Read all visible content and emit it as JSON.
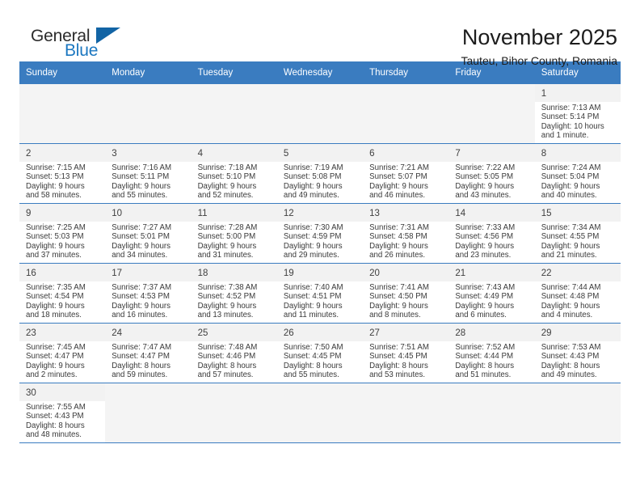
{
  "brand": {
    "name_part1": "General",
    "name_part2": "Blue",
    "triangle_icon": "triangle-icon",
    "accent_color": "#1b77c0"
  },
  "header": {
    "title": "November 2025",
    "subtitle": "Tauteu, Bihor County, Romania"
  },
  "theme": {
    "header_row_bg": "#3a7cc0",
    "header_row_text": "#ffffff",
    "daynum_bar_bg": "#f2f2f2",
    "grid_line": "#3a7cc0"
  },
  "weekdays": [
    {
      "label": "Sunday"
    },
    {
      "label": "Monday"
    },
    {
      "label": "Tuesday"
    },
    {
      "label": "Wednesday"
    },
    {
      "label": "Thursday"
    },
    {
      "label": "Friday"
    },
    {
      "label": "Saturday"
    }
  ],
  "weeks": [
    [
      {
        "empty": true
      },
      {
        "empty": true
      },
      {
        "empty": true
      },
      {
        "empty": true
      },
      {
        "empty": true
      },
      {
        "empty": true
      },
      {
        "day": "1",
        "sunrise": "Sunrise: 7:13 AM",
        "sunset": "Sunset: 5:14 PM",
        "daylight1": "Daylight: 10 hours",
        "daylight2": "and 1 minute."
      }
    ],
    [
      {
        "day": "2",
        "sunrise": "Sunrise: 7:15 AM",
        "sunset": "Sunset: 5:13 PM",
        "daylight1": "Daylight: 9 hours",
        "daylight2": "and 58 minutes."
      },
      {
        "day": "3",
        "sunrise": "Sunrise: 7:16 AM",
        "sunset": "Sunset: 5:11 PM",
        "daylight1": "Daylight: 9 hours",
        "daylight2": "and 55 minutes."
      },
      {
        "day": "4",
        "sunrise": "Sunrise: 7:18 AM",
        "sunset": "Sunset: 5:10 PM",
        "daylight1": "Daylight: 9 hours",
        "daylight2": "and 52 minutes."
      },
      {
        "day": "5",
        "sunrise": "Sunrise: 7:19 AM",
        "sunset": "Sunset: 5:08 PM",
        "daylight1": "Daylight: 9 hours",
        "daylight2": "and 49 minutes."
      },
      {
        "day": "6",
        "sunrise": "Sunrise: 7:21 AM",
        "sunset": "Sunset: 5:07 PM",
        "daylight1": "Daylight: 9 hours",
        "daylight2": "and 46 minutes."
      },
      {
        "day": "7",
        "sunrise": "Sunrise: 7:22 AM",
        "sunset": "Sunset: 5:05 PM",
        "daylight1": "Daylight: 9 hours",
        "daylight2": "and 43 minutes."
      },
      {
        "day": "8",
        "sunrise": "Sunrise: 7:24 AM",
        "sunset": "Sunset: 5:04 PM",
        "daylight1": "Daylight: 9 hours",
        "daylight2": "and 40 minutes."
      }
    ],
    [
      {
        "day": "9",
        "sunrise": "Sunrise: 7:25 AM",
        "sunset": "Sunset: 5:03 PM",
        "daylight1": "Daylight: 9 hours",
        "daylight2": "and 37 minutes."
      },
      {
        "day": "10",
        "sunrise": "Sunrise: 7:27 AM",
        "sunset": "Sunset: 5:01 PM",
        "daylight1": "Daylight: 9 hours",
        "daylight2": "and 34 minutes."
      },
      {
        "day": "11",
        "sunrise": "Sunrise: 7:28 AM",
        "sunset": "Sunset: 5:00 PM",
        "daylight1": "Daylight: 9 hours",
        "daylight2": "and 31 minutes."
      },
      {
        "day": "12",
        "sunrise": "Sunrise: 7:30 AM",
        "sunset": "Sunset: 4:59 PM",
        "daylight1": "Daylight: 9 hours",
        "daylight2": "and 29 minutes."
      },
      {
        "day": "13",
        "sunrise": "Sunrise: 7:31 AM",
        "sunset": "Sunset: 4:58 PM",
        "daylight1": "Daylight: 9 hours",
        "daylight2": "and 26 minutes."
      },
      {
        "day": "14",
        "sunrise": "Sunrise: 7:33 AM",
        "sunset": "Sunset: 4:56 PM",
        "daylight1": "Daylight: 9 hours",
        "daylight2": "and 23 minutes."
      },
      {
        "day": "15",
        "sunrise": "Sunrise: 7:34 AM",
        "sunset": "Sunset: 4:55 PM",
        "daylight1": "Daylight: 9 hours",
        "daylight2": "and 21 minutes."
      }
    ],
    [
      {
        "day": "16",
        "sunrise": "Sunrise: 7:35 AM",
        "sunset": "Sunset: 4:54 PM",
        "daylight1": "Daylight: 9 hours",
        "daylight2": "and 18 minutes."
      },
      {
        "day": "17",
        "sunrise": "Sunrise: 7:37 AM",
        "sunset": "Sunset: 4:53 PM",
        "daylight1": "Daylight: 9 hours",
        "daylight2": "and 16 minutes."
      },
      {
        "day": "18",
        "sunrise": "Sunrise: 7:38 AM",
        "sunset": "Sunset: 4:52 PM",
        "daylight1": "Daylight: 9 hours",
        "daylight2": "and 13 minutes."
      },
      {
        "day": "19",
        "sunrise": "Sunrise: 7:40 AM",
        "sunset": "Sunset: 4:51 PM",
        "daylight1": "Daylight: 9 hours",
        "daylight2": "and 11 minutes."
      },
      {
        "day": "20",
        "sunrise": "Sunrise: 7:41 AM",
        "sunset": "Sunset: 4:50 PM",
        "daylight1": "Daylight: 9 hours",
        "daylight2": "and 8 minutes."
      },
      {
        "day": "21",
        "sunrise": "Sunrise: 7:43 AM",
        "sunset": "Sunset: 4:49 PM",
        "daylight1": "Daylight: 9 hours",
        "daylight2": "and 6 minutes."
      },
      {
        "day": "22",
        "sunrise": "Sunrise: 7:44 AM",
        "sunset": "Sunset: 4:48 PM",
        "daylight1": "Daylight: 9 hours",
        "daylight2": "and 4 minutes."
      }
    ],
    [
      {
        "day": "23",
        "sunrise": "Sunrise: 7:45 AM",
        "sunset": "Sunset: 4:47 PM",
        "daylight1": "Daylight: 9 hours",
        "daylight2": "and 2 minutes."
      },
      {
        "day": "24",
        "sunrise": "Sunrise: 7:47 AM",
        "sunset": "Sunset: 4:47 PM",
        "daylight1": "Daylight: 8 hours",
        "daylight2": "and 59 minutes."
      },
      {
        "day": "25",
        "sunrise": "Sunrise: 7:48 AM",
        "sunset": "Sunset: 4:46 PM",
        "daylight1": "Daylight: 8 hours",
        "daylight2": "and 57 minutes."
      },
      {
        "day": "26",
        "sunrise": "Sunrise: 7:50 AM",
        "sunset": "Sunset: 4:45 PM",
        "daylight1": "Daylight: 8 hours",
        "daylight2": "and 55 minutes."
      },
      {
        "day": "27",
        "sunrise": "Sunrise: 7:51 AM",
        "sunset": "Sunset: 4:45 PM",
        "daylight1": "Daylight: 8 hours",
        "daylight2": "and 53 minutes."
      },
      {
        "day": "28",
        "sunrise": "Sunrise: 7:52 AM",
        "sunset": "Sunset: 4:44 PM",
        "daylight1": "Daylight: 8 hours",
        "daylight2": "and 51 minutes."
      },
      {
        "day": "29",
        "sunrise": "Sunrise: 7:53 AM",
        "sunset": "Sunset: 4:43 PM",
        "daylight1": "Daylight: 8 hours",
        "daylight2": "and 49 minutes."
      }
    ],
    [
      {
        "day": "30",
        "sunrise": "Sunrise: 7:55 AM",
        "sunset": "Sunset: 4:43 PM",
        "daylight1": "Daylight: 8 hours",
        "daylight2": "and 48 minutes."
      },
      {
        "empty": true
      },
      {
        "empty": true
      },
      {
        "empty": true
      },
      {
        "empty": true
      },
      {
        "empty": true
      },
      {
        "empty": true
      }
    ]
  ]
}
